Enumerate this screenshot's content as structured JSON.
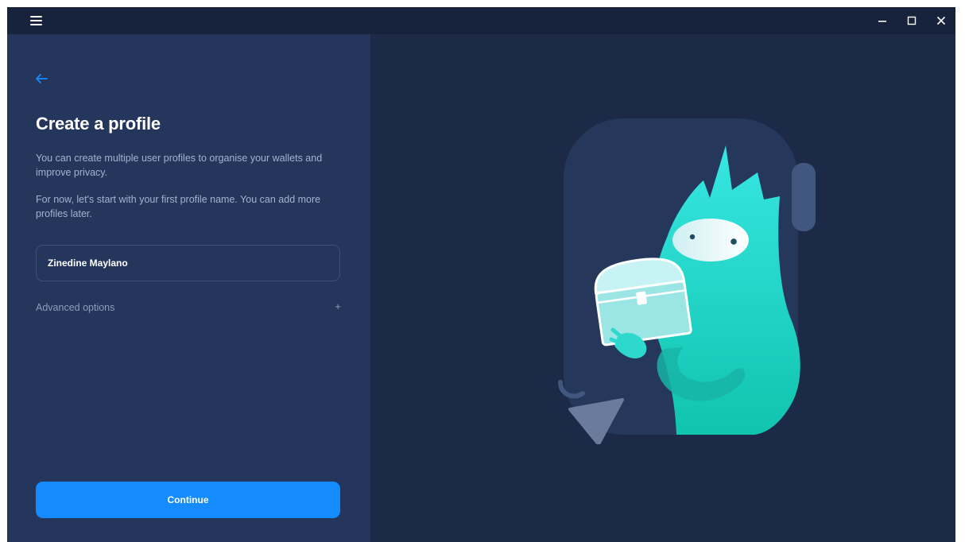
{
  "window": {
    "controls": {
      "menu_icon": "hamburger-menu-icon",
      "minimize_icon": "minimize-icon",
      "maximize_icon": "maximize-icon",
      "close_icon": "close-icon"
    }
  },
  "form": {
    "back_icon": "arrow-left-icon",
    "title": "Create a profile",
    "description_1": "You can create multiple user profiles to organise your wallets and improve privacy.",
    "description_2": "For now, let's start with your first profile name. You can add more profiles later.",
    "profile_name_value": "Zinedine Maylano",
    "advanced_options_label": "Advanced options",
    "advanced_options_icon": "+",
    "continue_label": "Continue"
  },
  "colors": {
    "accent": "#148bff",
    "panel": "#25365c",
    "background": "#1c2a48",
    "character": "#17d1bd"
  }
}
